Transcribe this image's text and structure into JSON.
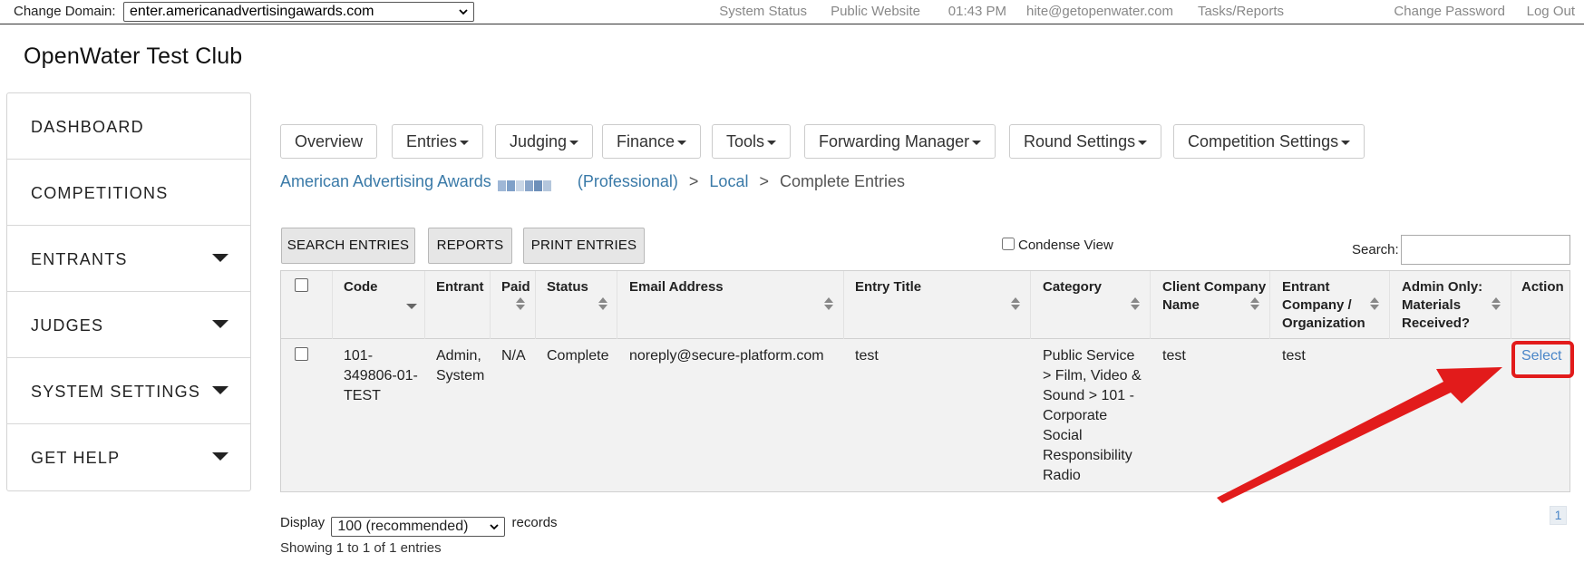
{
  "topbar": {
    "domain_label": "Change Domain:",
    "domain_value": "enter.americanadvertisingawards.com",
    "links": [
      "System Status",
      "Public Website",
      "01:43 PM",
      "hite@getopenwater.com",
      "Tasks/Reports",
      "Change Password",
      "Log Out"
    ]
  },
  "club_title": "OpenWater Test Club",
  "sidebar": {
    "items": [
      {
        "label": "DASHBOARD",
        "expandable": false
      },
      {
        "label": "COMPETITIONS",
        "expandable": false
      },
      {
        "label": "ENTRANTS",
        "expandable": true
      },
      {
        "label": "JUDGES",
        "expandable": true
      },
      {
        "label": "SYSTEM SETTINGS",
        "expandable": true
      },
      {
        "label": "GET HELP",
        "expandable": true
      }
    ]
  },
  "nav": {
    "overview": "Overview",
    "entries": "Entries",
    "judging": "Judging",
    "finance": "Finance",
    "tools": "Tools",
    "forwarding": "Forwarding Manager",
    "round_settings": "Round Settings",
    "competition_settings": "Competition Settings"
  },
  "breadcrumb": {
    "competition": "American Advertising Awards",
    "program": "(Professional)",
    "level": "Local",
    "current": "Complete Entries",
    "separator": ">"
  },
  "actions": {
    "search_entries": "SEARCH ENTRIES",
    "reports": "REPORTS",
    "print_entries": "PRINT ENTRIES",
    "condense_view": "Condense View",
    "search_label": "Search:",
    "search_value": ""
  },
  "table": {
    "headers": {
      "code": "Code",
      "entrant": "Entrant",
      "paid": "Paid",
      "status": "Status",
      "email": "Email Address",
      "title": "Entry Title",
      "category": "Category",
      "client_l1": "Client Company",
      "client_l2": "Name",
      "entrant_co_l1": "Entrant",
      "entrant_co_l2": "Company /",
      "entrant_co_l3": "Organization",
      "admin_l1": "Admin Only:",
      "admin_l2": "Materials",
      "admin_l3": "Received?",
      "action": "Action"
    },
    "row": {
      "code_l1": "101-",
      "code_l2": "349806-01-",
      "code_l3": "TEST",
      "entrant_l1": "Admin,",
      "entrant_l2": "System",
      "paid": "N/A",
      "status": "Complete",
      "email": "noreply@secure-platform.com",
      "title": "test",
      "cat_l1": "Public Service",
      "cat_l2": "> Film, Video &",
      "cat_l3": "Sound > 101 -",
      "cat_l4": "Corporate",
      "cat_l5": "Social",
      "cat_l6": "Responsibility",
      "cat_l7": "Radio",
      "client_company": "test",
      "entrant_company": "test",
      "admin_materials": "",
      "action": "Select"
    }
  },
  "footer": {
    "display_label": "Display",
    "display_value": "100 (recommended)",
    "records_label": "records",
    "showing": "Showing 1 to 1 of 1 entries",
    "page": "1"
  },
  "colors": {
    "link": "#3a7aa8",
    "highlight": "#e21b1b",
    "table_bg": "#f2f2f2",
    "button_bg": "#e6e6e6"
  }
}
